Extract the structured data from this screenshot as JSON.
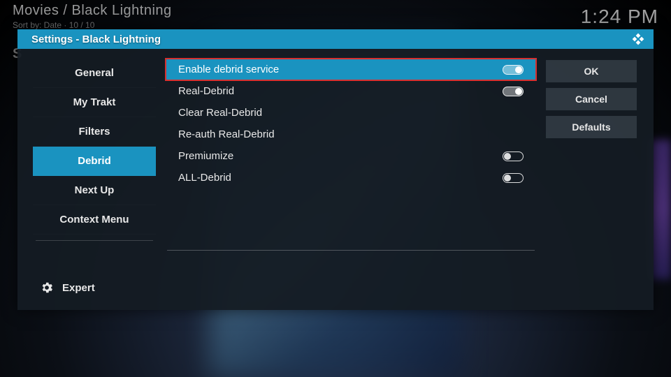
{
  "topbar": {
    "breadcrumb": "Movies / Black Lightning",
    "sort_line": "Sort by: Date  ·  10 / 10",
    "clock": "1:24 PM",
    "bg_letter": "S"
  },
  "dialog": {
    "title": "Settings - Black Lightning"
  },
  "sidebar": {
    "items": [
      {
        "label": "General"
      },
      {
        "label": "My Trakt"
      },
      {
        "label": "Filters"
      },
      {
        "label": "Debrid"
      },
      {
        "label": "Next Up"
      },
      {
        "label": "Context Menu"
      }
    ],
    "selected_index": 3,
    "level_label": "Expert"
  },
  "options": [
    {
      "label": "Enable debrid service",
      "type": "toggle",
      "value": true,
      "highlight": true
    },
    {
      "label": "Real-Debrid",
      "type": "toggle",
      "value": true
    },
    {
      "label": "Clear Real-Debrid",
      "type": "action"
    },
    {
      "label": "Re-auth Real-Debrid",
      "type": "action"
    },
    {
      "label": "Premiumize",
      "type": "toggle",
      "value": false
    },
    {
      "label": "ALL-Debrid",
      "type": "toggle",
      "value": false
    }
  ],
  "actions": {
    "ok": "OK",
    "cancel": "Cancel",
    "defaults": "Defaults"
  },
  "colors": {
    "accent": "#1a93c0",
    "highlight_border": "#d63030"
  }
}
